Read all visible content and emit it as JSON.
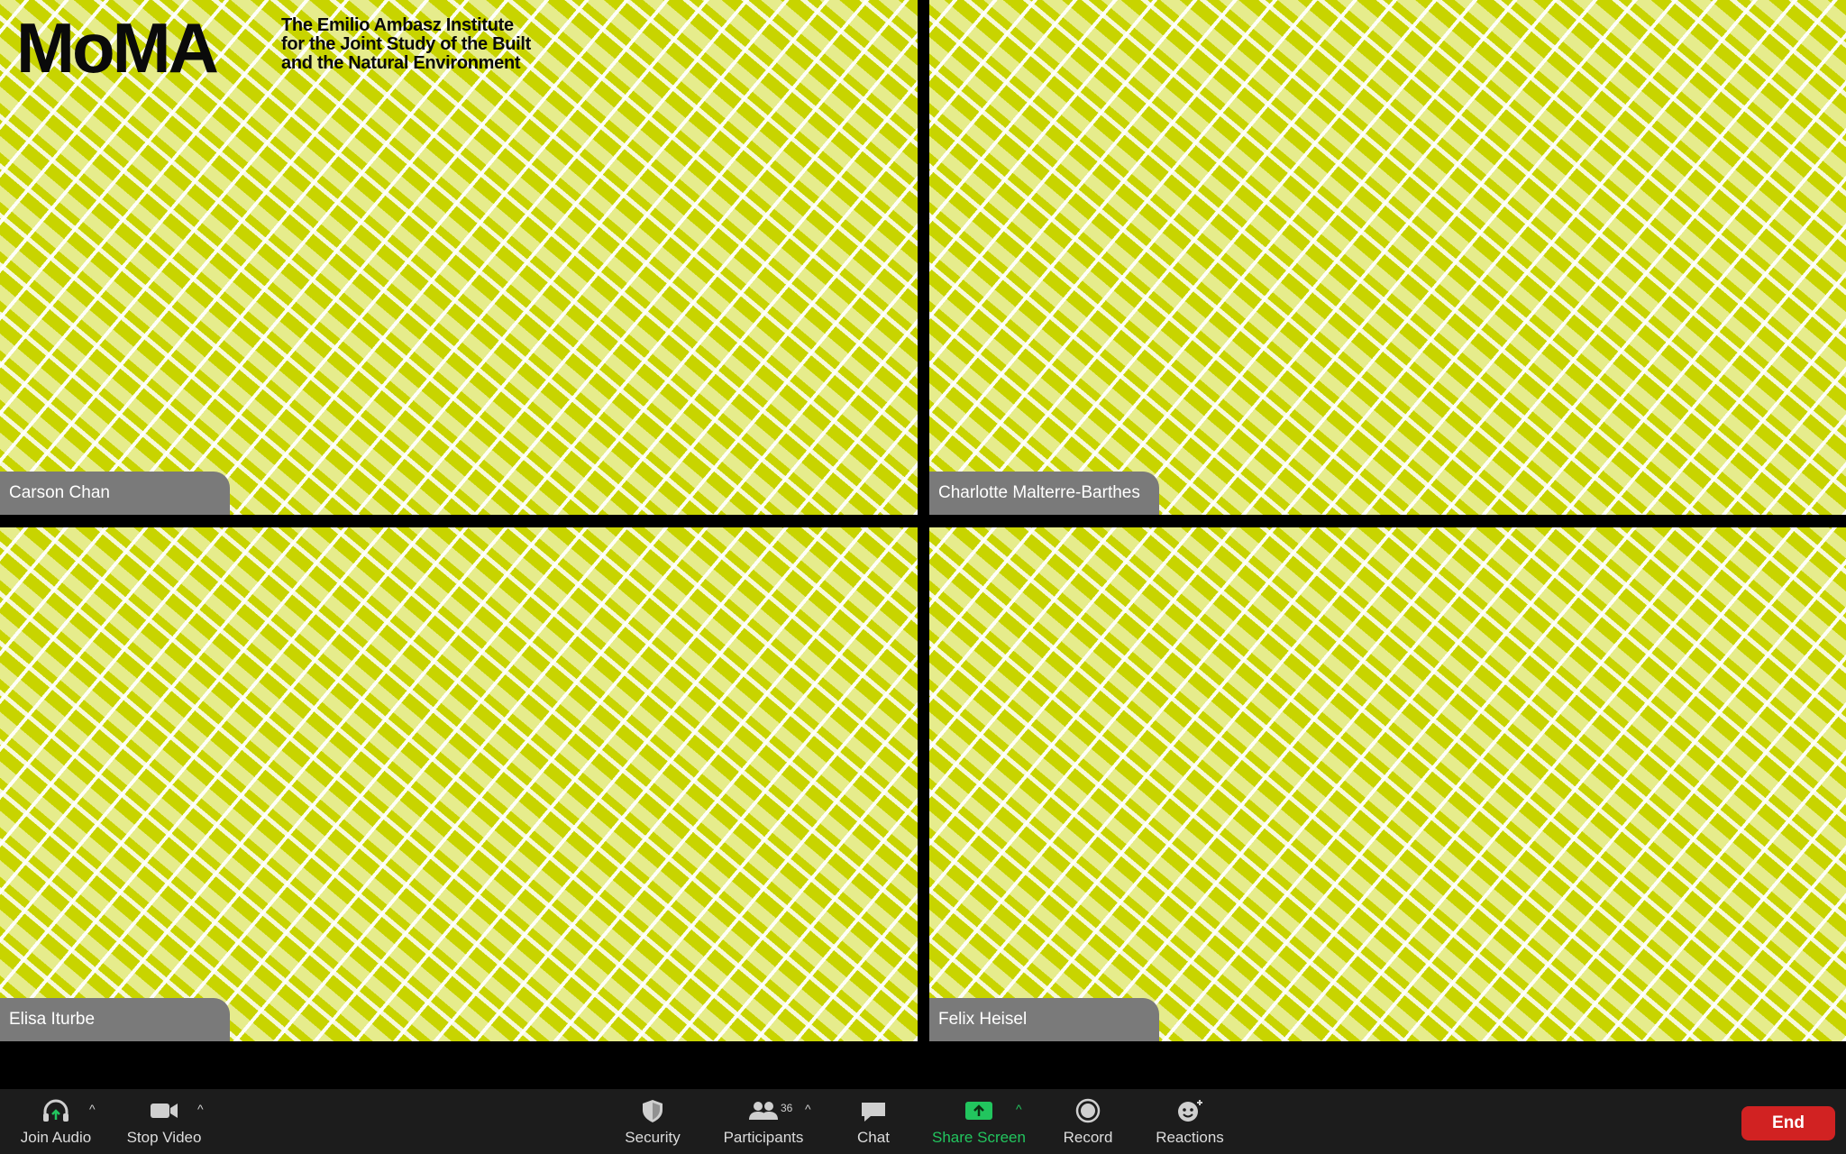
{
  "header": {
    "logo": "MoMA",
    "institute": "The Emilio Ambasz Institute\nfor the Joint Study of the Built\nand the Natural Environment"
  },
  "participants_tiles": [
    {
      "name": "Carson Chan"
    },
    {
      "name": "Charlotte Malterre-Barthes"
    },
    {
      "name": "Elisa Iturbe"
    },
    {
      "name": "Felix Heisel"
    }
  ],
  "toolbar": {
    "join_audio": "Join Audio",
    "stop_video": "Stop Video",
    "security": "Security",
    "participants": "Participants",
    "participants_count": "36",
    "chat": "Chat",
    "share_screen": "Share Screen",
    "record": "Record",
    "reactions": "Reactions",
    "end": "End"
  },
  "colors": {
    "tile_bg": "#c8d400",
    "share_green": "#22c55e",
    "end_red": "#d12222",
    "toolbar_bg": "#1c1c1c"
  }
}
